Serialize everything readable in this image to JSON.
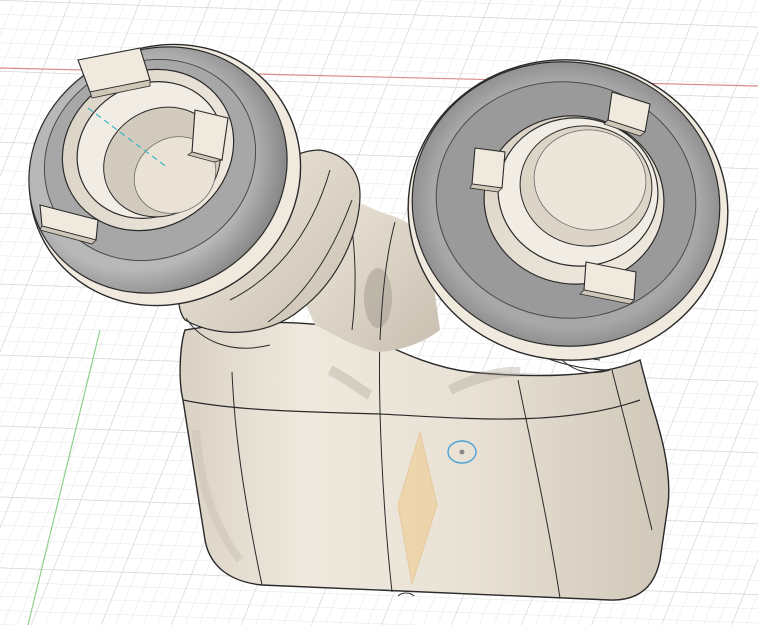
{
  "canvas": {
    "background": "#ffffff",
    "grid_minor_color": "#e3e3e3",
    "grid_major_color": "#cfcfcf",
    "axis_x_color": "#d98a8a",
    "axis_y_color": "#8ed08e"
  },
  "model": {
    "body_fill": "#eae3d6",
    "body_shade": "#c9c1b3",
    "rim_dark": "#8e8e8e",
    "rim_light": "#bdbdbd",
    "face_fill": "#9a9a9a",
    "edge_color": "#2a2a2a",
    "highlight_color": "#f0c98a",
    "sketch_line_color": "#3fb8c8",
    "pivot_color": "#4aa3d8"
  }
}
